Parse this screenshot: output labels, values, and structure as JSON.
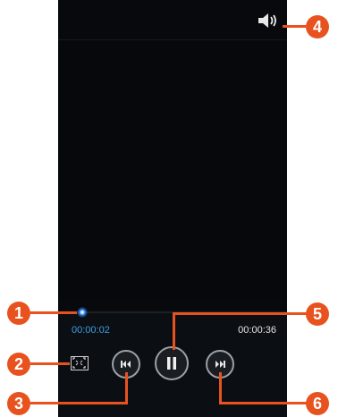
{
  "player": {
    "elapsed_time": "00:00:02",
    "total_time": "00:00:36",
    "progress_fraction": 0.055
  },
  "icons": {
    "volume": "speaker-icon",
    "fit": "fit-screen-icon",
    "previous": "skip-previous-icon",
    "pause": "pause-icon",
    "next": "skip-next-icon"
  },
  "callouts": {
    "c1": "1",
    "c2": "2",
    "c3": "3",
    "c4": "4",
    "c5": "5",
    "c6": "6"
  },
  "colors": {
    "accent": "#3ea0e6",
    "callout": "#e8521f",
    "screen": "#07090d"
  }
}
